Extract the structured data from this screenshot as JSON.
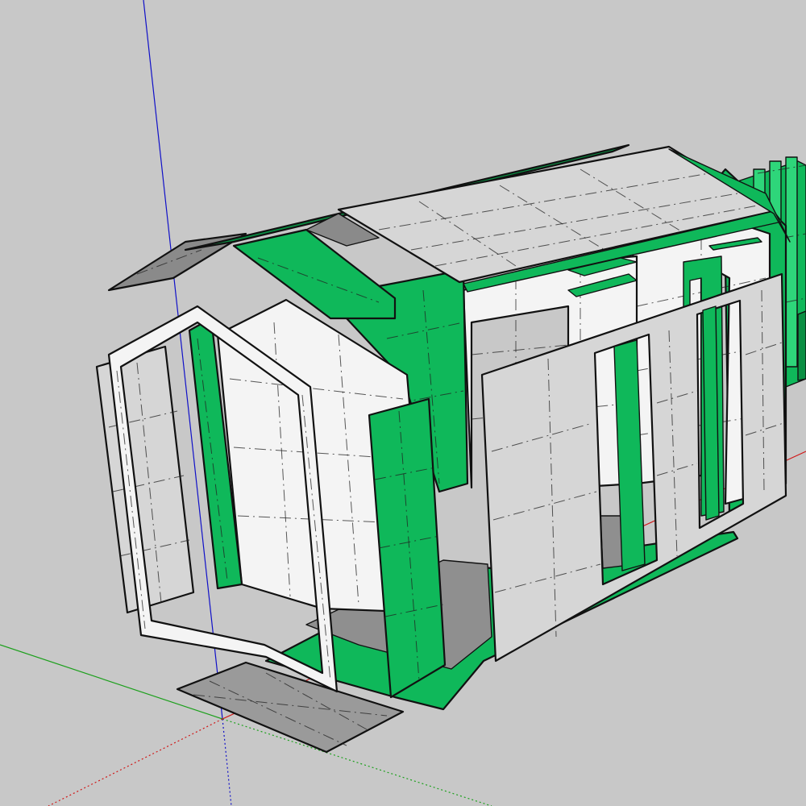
{
  "viewport": {
    "background": "#c8c8c8",
    "colors": {
      "green_panel": "#0fb85a",
      "green_dark": "#0a8f43",
      "green_light": "#2ed67a",
      "white_panel": "#f4f4f4",
      "gray_panel": "#d6d6d6",
      "floor_gray": "#8f8f8f",
      "outline": "#111111"
    },
    "axes": {
      "red_axis": "#d01818",
      "green_axis": "#1ca01c",
      "blue_axis": "#1010c8"
    },
    "icons": [
      "model-axes"
    ]
  }
}
